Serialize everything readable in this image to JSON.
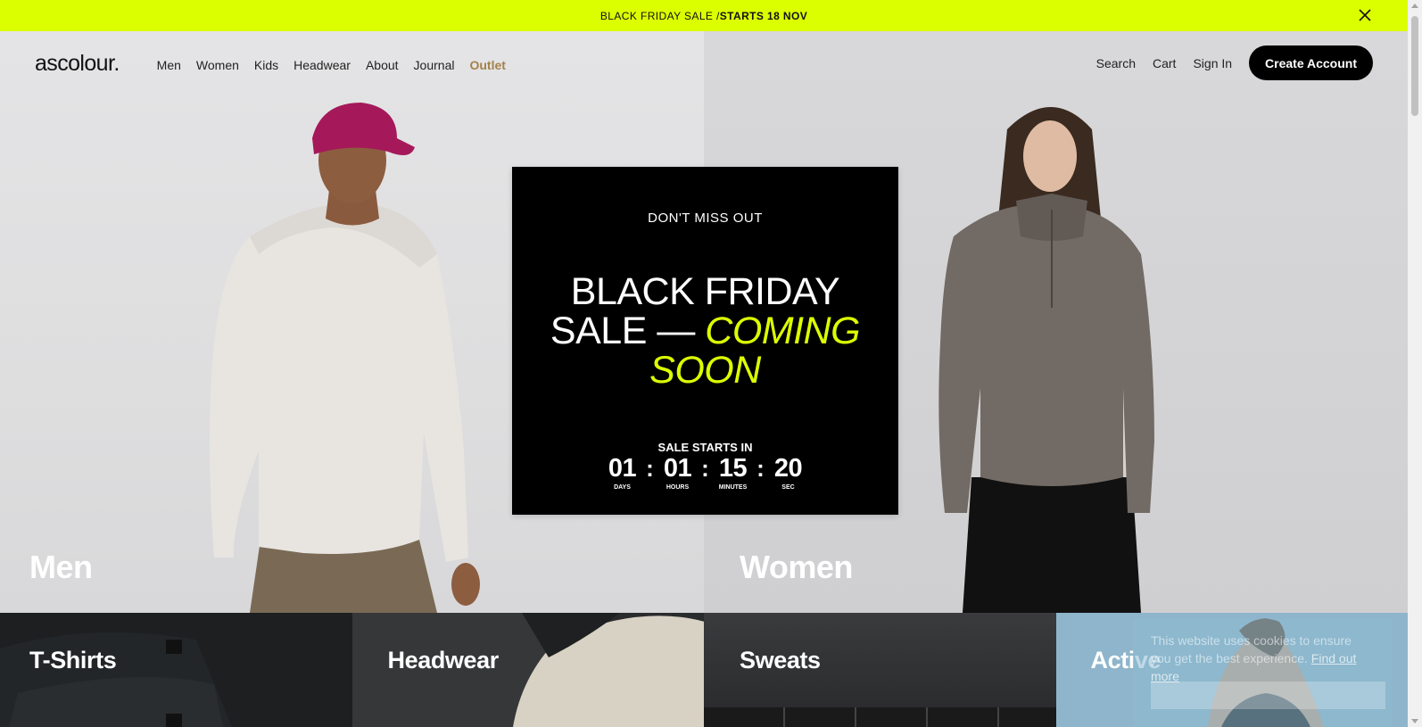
{
  "announcement": {
    "text": "BLACK FRIDAY SALE / ",
    "emphasis": "STARTS 18 NOV",
    "close_icon": "close-icon"
  },
  "header": {
    "logo": "ascolour.",
    "nav": [
      "Men",
      "Women",
      "Kids",
      "Headwear",
      "About",
      "Journal",
      "Outlet"
    ],
    "search": "Search",
    "cart": "Cart",
    "sign_in": "Sign In",
    "create_account": "Create Account"
  },
  "hero": {
    "left_label": "Men",
    "right_label": "Women"
  },
  "promo_card": {
    "eyebrow": "DON'T MISS OUT",
    "headline_line1": "BLACK FRIDAY",
    "headline_line2_prefix": "SALE — ",
    "headline_accent_1": "COMING",
    "headline_accent_2": "SOON",
    "starts_label": "SALE STARTS IN",
    "countdown": {
      "days": "01",
      "days_label": "DAYS",
      "hours": "01",
      "hours_label": "HOURS",
      "minutes": "15",
      "minutes_label": "MINUTES",
      "seconds": "20",
      "seconds_label": "SEC",
      "separator": ":"
    }
  },
  "tiles": [
    "T-Shirts",
    "Headwear",
    "Sweats",
    "Active"
  ],
  "cookie": {
    "text": "This website uses cookies to ensure you get the best experience.",
    "link": "Find out more"
  },
  "colors": {
    "accent": "#dcff00",
    "outlet": "#a4814a",
    "black": "#000000"
  }
}
